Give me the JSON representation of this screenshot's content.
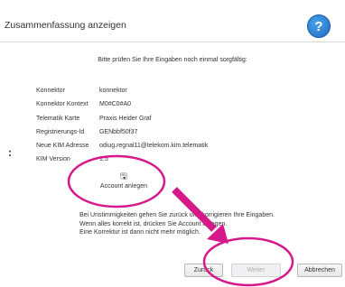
{
  "dialog": {
    "title": "Zusammenfassung anzeigen",
    "help_symbol": "?"
  },
  "intro": "Bitte prüfen Sie Ihre Eingaben noch einmal sorgfältig:",
  "summary": [
    {
      "label": "Konnektor",
      "value": "konnektor"
    },
    {
      "label": "Konnektor Kontext",
      "value": "M0#C0#A0"
    },
    {
      "label": "Telematik Karte",
      "value": "Praxis Heider Graf"
    },
    {
      "label": "Registrierungs-Id",
      "value": "GENbbf50f37"
    },
    {
      "label": "Neue KIM Adresse",
      "value": "odiug.regnal11@telekom.kim.telematik"
    },
    {
      "label": "KIM Version",
      "value": "1.5"
    }
  ],
  "account": {
    "icon": "save-disk-icon",
    "label": "Account anlegen"
  },
  "note": {
    "line1": "Bei Unstimmigkeiten gehen Sie zurück und korrigieren Ihre Eingaben.",
    "line2": "Wenn alles korrekt ist, drücken Sie Account anlegen.",
    "line3": "Eine Korrektur ist dann nicht mehr möglich."
  },
  "buttons": {
    "back": "Zurück",
    "next": "Weiter",
    "cancel": "Abbrechen"
  },
  "side_marker": ":",
  "annotations": {
    "color": "#d6198a"
  }
}
